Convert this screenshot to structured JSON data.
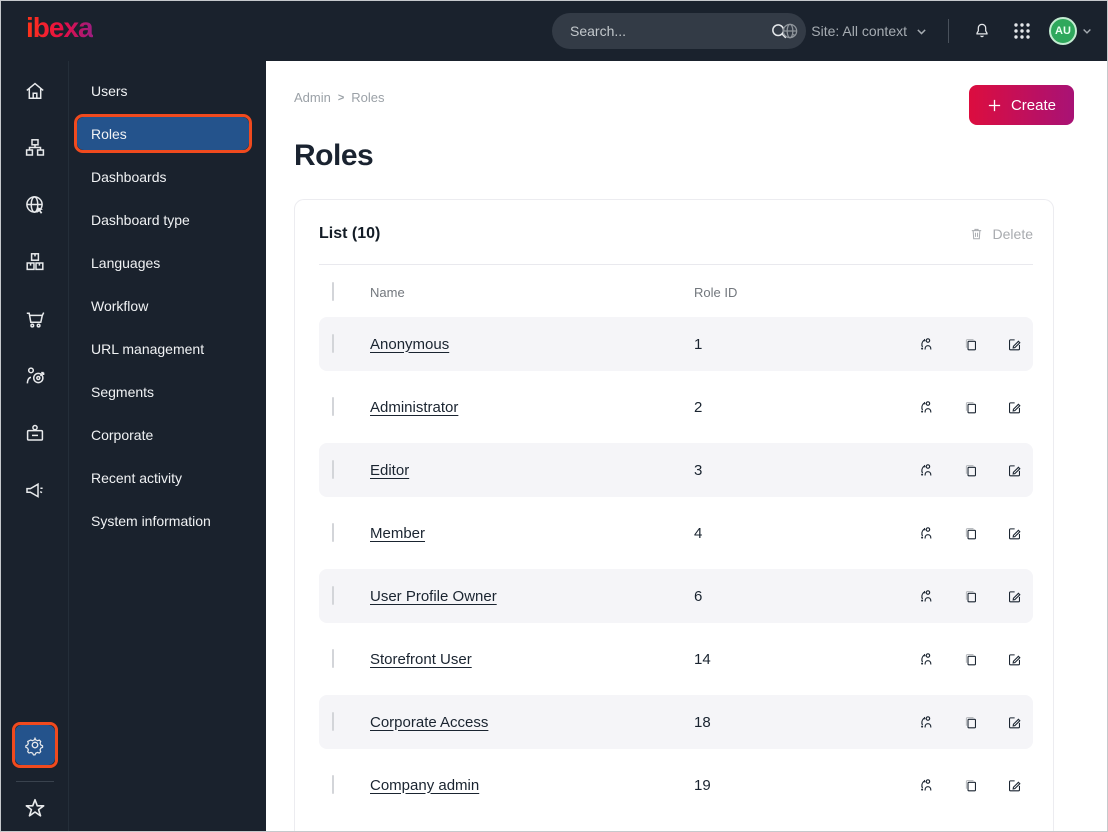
{
  "topbar": {
    "logo_text": "ibexa",
    "search": {
      "placeholder": "Search..."
    },
    "site_context": {
      "label": "Site: All context",
      "icon": "globe-icon"
    },
    "icons": [
      "bell-icon",
      "app-grid-icon"
    ],
    "avatar": {
      "initials": "AU"
    }
  },
  "icon_rail": {
    "items": [
      {
        "icon": "home"
      },
      {
        "icon": "sitemap"
      },
      {
        "icon": "globe-cursor"
      },
      {
        "icon": "packages"
      },
      {
        "icon": "cart"
      },
      {
        "icon": "audience-target"
      },
      {
        "icon": "badge"
      },
      {
        "icon": "megaphone"
      }
    ],
    "bottom": [
      {
        "icon": "gear",
        "selected": true,
        "highlighted": true
      },
      {
        "icon": "star"
      }
    ]
  },
  "sidebar": {
    "items": [
      {
        "label": "Users",
        "selected": false
      },
      {
        "label": "Roles",
        "selected": true,
        "highlighted": true
      },
      {
        "label": "Dashboards",
        "selected": false
      },
      {
        "label": "Dashboard type",
        "selected": false
      },
      {
        "label": "Languages",
        "selected": false
      },
      {
        "label": "Workflow",
        "selected": false
      },
      {
        "label": "URL management",
        "selected": false
      },
      {
        "label": "Segments",
        "selected": false
      },
      {
        "label": "Corporate",
        "selected": false
      },
      {
        "label": "Recent activity",
        "selected": false
      },
      {
        "label": "System information",
        "selected": false
      }
    ]
  },
  "main": {
    "breadcrumb": {
      "items": [
        "Admin",
        "Roles"
      ],
      "separator": ">"
    },
    "title": "Roles",
    "create_label": "Create",
    "table": {
      "title": "List (10)",
      "delete_label": "Delete",
      "columns": {
        "name": "Name",
        "role_id": "Role ID"
      },
      "row_action_icons": [
        "assign-user-icon",
        "copy-icon",
        "edit-icon"
      ],
      "rows": [
        {
          "name": "Anonymous",
          "role_id": "1"
        },
        {
          "name": "Administrator",
          "role_id": "2"
        },
        {
          "name": "Editor",
          "role_id": "3"
        },
        {
          "name": "Member",
          "role_id": "4"
        },
        {
          "name": "User Profile Owner",
          "role_id": "6"
        },
        {
          "name": "Storefront User",
          "role_id": "14"
        },
        {
          "name": "Corporate Access",
          "role_id": "18"
        },
        {
          "name": "Company admin",
          "role_id": "19"
        }
      ]
    }
  },
  "colors": {
    "topbar_bg": "#1a222d",
    "selected_blue": "#24538c",
    "highlight_orange": "#f04a1e",
    "create_gradient_start": "#dc0d3f",
    "create_gradient_end": "#a81275",
    "row_alt_bg": "#f5f5f8",
    "avatar_green": "#2fa85c",
    "text_dark": "#1a2330"
  }
}
